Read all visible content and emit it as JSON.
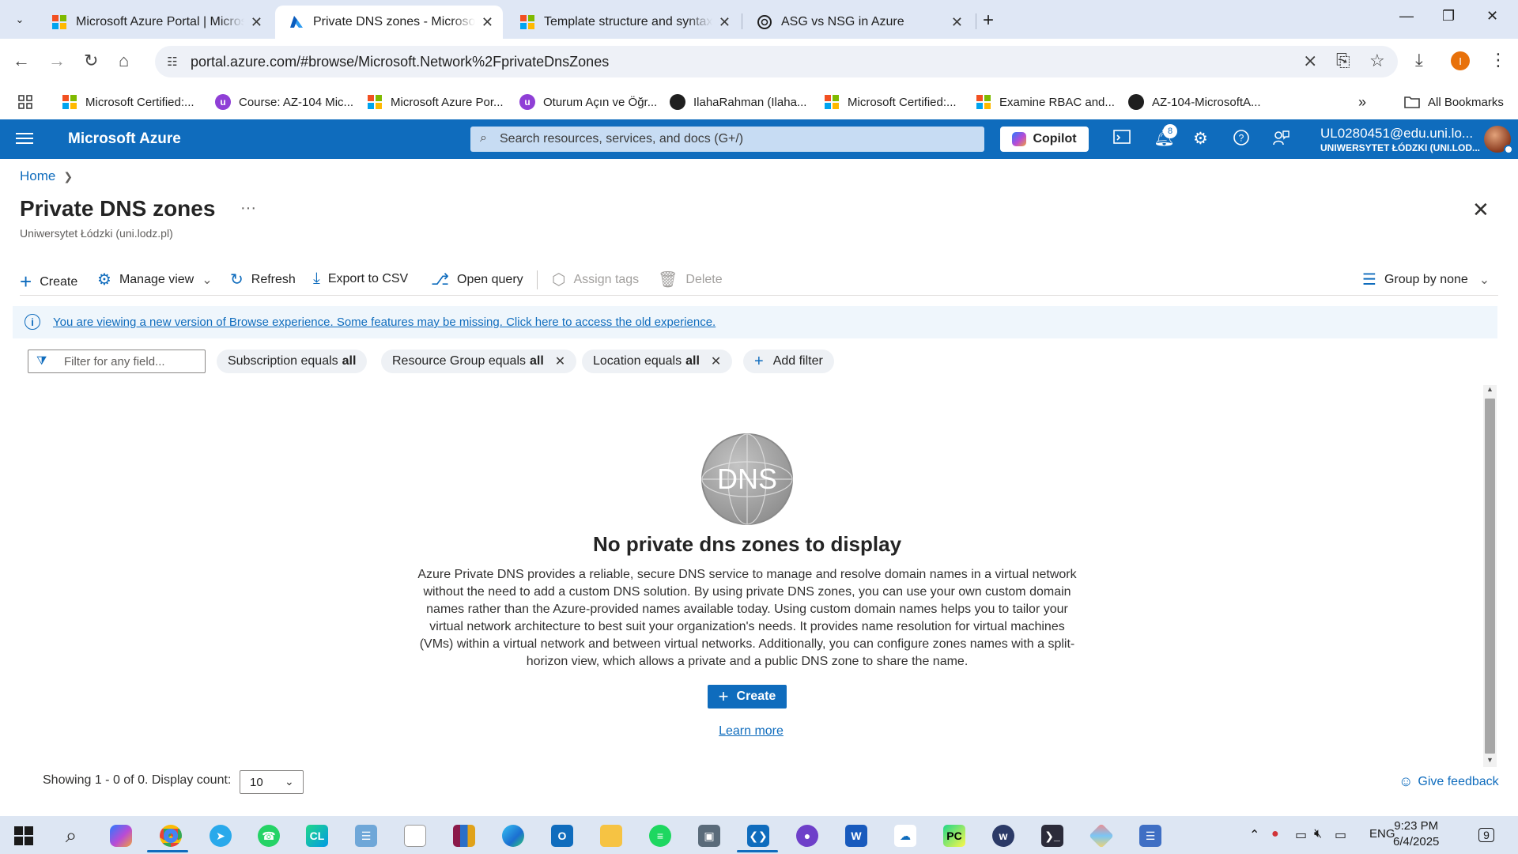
{
  "browser": {
    "tabs": [
      {
        "title": "Microsoft Azure Portal | Microsoft",
        "icon": "microsoft-logo",
        "active": false
      },
      {
        "title": "Private DNS zones - Microsoft Azure",
        "icon": "azure-logo",
        "active": true
      },
      {
        "title": "Template structure and syntax - A",
        "icon": "microsoft-logo",
        "active": false
      },
      {
        "title": "ASG vs NSG in Azure",
        "icon": "openai-logo",
        "active": false
      }
    ],
    "url": "portal.azure.com/#browse/Microsoft.Network%2FprivateDnsZones",
    "profile_initial": "I",
    "bookmarks": [
      {
        "label": "Microsoft Certified:...",
        "icon": "microsoft-logo"
      },
      {
        "label": "Course: AZ-104 Mic...",
        "icon": "udemy-icon"
      },
      {
        "label": "Microsoft Azure Por...",
        "icon": "microsoft-logo"
      },
      {
        "label": "Oturum Açın ve Öğr...",
        "icon": "udemy-icon"
      },
      {
        "label": "IlahaRahman (Ilaha...",
        "icon": "github-icon"
      },
      {
        "label": "Microsoft Certified:...",
        "icon": "microsoft-logo"
      },
      {
        "label": "Examine RBAC and...",
        "icon": "microsoft-logo"
      },
      {
        "label": "AZ-104-MicrosoftA...",
        "icon": "github-icon"
      }
    ],
    "all_bookmarks": "All Bookmarks"
  },
  "azure": {
    "brand": "Microsoft Azure",
    "search_placeholder": "Search resources, services, and docs (G+/)",
    "copilot": "Copilot",
    "notification_count": "8",
    "account_name": "UL0280451@edu.uni.lo...",
    "account_tenant": "UNIWERSYTET ŁÓDZKI (UNI.LOD..."
  },
  "page": {
    "breadcrumb_home": "Home",
    "title": "Private DNS zones",
    "subtitle": "Uniwersytet Łódzki (uni.lodz.pl)",
    "commands": {
      "create": "Create",
      "manage_view": "Manage view",
      "refresh": "Refresh",
      "export": "Export to CSV",
      "open_query": "Open query",
      "assign_tags": "Assign tags",
      "delete": "Delete",
      "group_by": "Group by none"
    },
    "info_message": "You are viewing a new version of Browse experience. Some features may be missing. Click here to access the old experience.",
    "filter_placeholder": "Filter for any field...",
    "filters": [
      {
        "field": "Subscription",
        "op": "equals",
        "value": "all",
        "removable": false
      },
      {
        "field": "Resource Group",
        "op": "equals",
        "value": "all",
        "removable": true
      },
      {
        "field": "Location",
        "op": "equals",
        "value": "all",
        "removable": true
      }
    ],
    "add_filter": "Add filter",
    "empty_state": {
      "icon_text": "DNS",
      "title": "No private dns zones to display",
      "description": "Azure Private DNS provides a reliable, secure DNS service to manage and resolve domain names in a virtual network without the need to add a custom DNS solution. By using private DNS zones, you can use your own custom domain names rather than the Azure-provided names available today. Using custom domain names helps you to tailor your virtual network architecture to best suit your organization's needs. It provides name resolution for virtual machines (VMs) within a virtual network and between virtual networks. Additionally, you can configure zones names with a split-horizon view, which allows a private and a public DNS zone to share the name.",
      "create_label": "Create",
      "learn_more": "Learn more"
    },
    "showing": "Showing 1 - 0 of 0. Display count:",
    "display_count": "10",
    "give_feedback": "Give feedback"
  },
  "taskbar": {
    "language": "ENG",
    "time": "9:23 PM",
    "date": "6/4/2025",
    "notifications": "9"
  }
}
